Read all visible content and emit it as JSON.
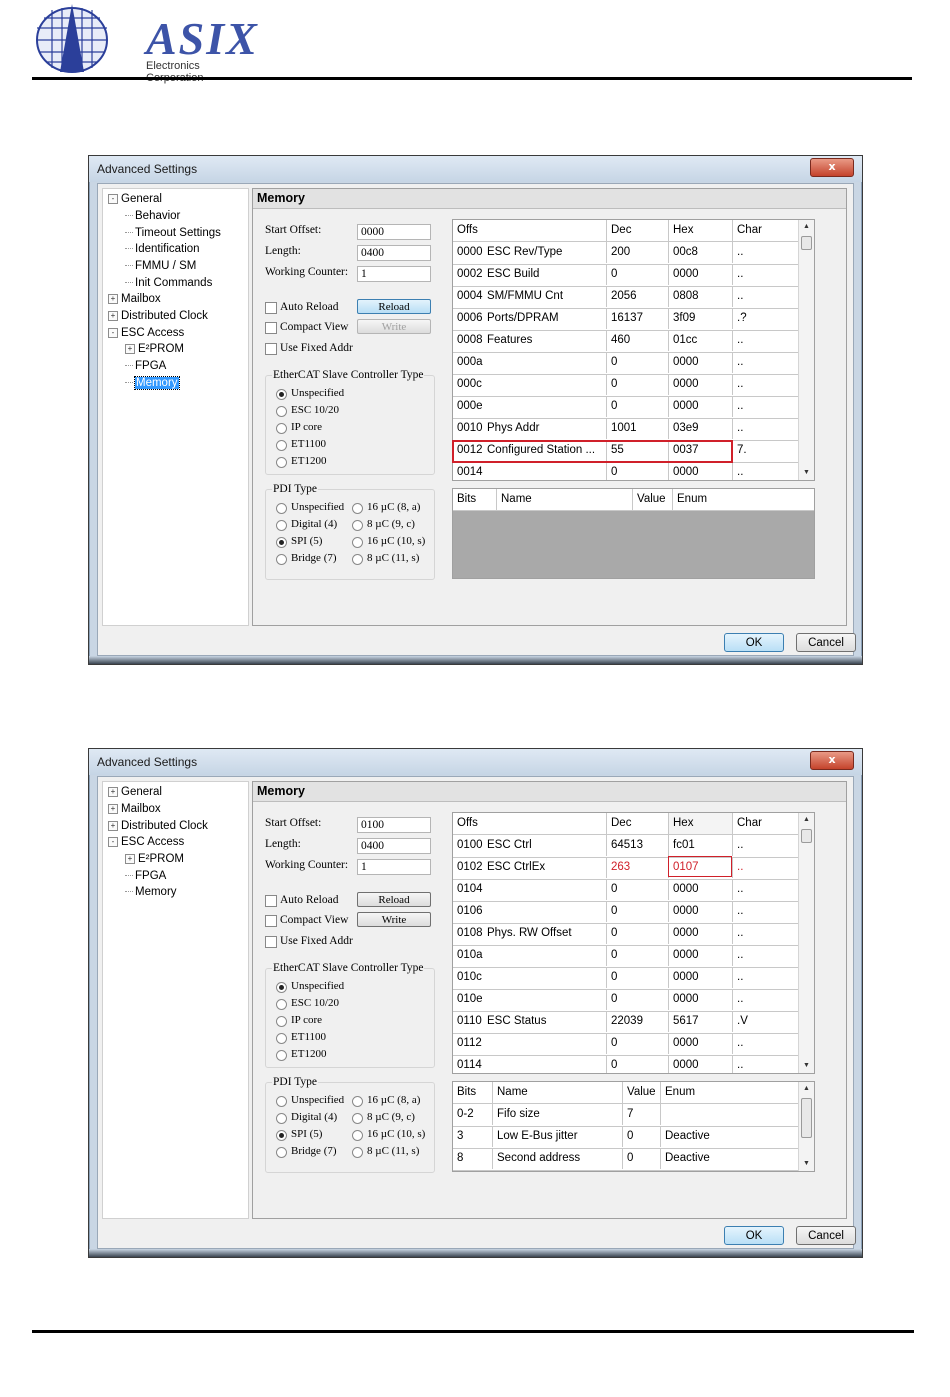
{
  "logo": {
    "brand": "ASIX",
    "subtitle": "Electronics Corporation"
  },
  "dialogs": [
    {
      "title": "Advanced Settings",
      "close_label": "x",
      "tree": [
        {
          "label": "General",
          "level": 0,
          "expander": "-"
        },
        {
          "label": "Behavior",
          "level": 1
        },
        {
          "label": "Timeout Settings",
          "level": 1
        },
        {
          "label": "Identification",
          "level": 1
        },
        {
          "label": "FMMU / SM",
          "level": 1
        },
        {
          "label": "Init Commands",
          "level": 1
        },
        {
          "label": "Mailbox",
          "level": 0,
          "expander": "+"
        },
        {
          "label": "Distributed Clock",
          "level": 0,
          "expander": "+"
        },
        {
          "label": "ESC Access",
          "level": 0,
          "expander": "-"
        },
        {
          "label": "E²PROM",
          "level": 1,
          "expander": "+"
        },
        {
          "label": "FPGA",
          "level": 1
        },
        {
          "label": "Memory",
          "level": 1,
          "selected": true
        }
      ],
      "panel_title": "Memory",
      "start_offset_label": "Start Offset:",
      "start_offset": "0000",
      "length_label": "Length:",
      "length": "0400",
      "working_counter_label": "Working Counter:",
      "working_counter": "1",
      "auto_reload_label": "Auto Reload",
      "reload_label": "Reload",
      "compact_view_label": "Compact View",
      "write_label": "Write",
      "write_disabled": true,
      "use_fixed_addr_label": "Use Fixed Addr",
      "esc_group_label": "EtherCAT Slave Controller Type",
      "esc_types": [
        "Unspecified",
        "ESC 10/20",
        "IP core",
        "ET1100",
        "ET1200"
      ],
      "esc_selected": 0,
      "pdi_group_label": "PDI Type",
      "pdi_left": [
        "Unspecified",
        "Digital (4)",
        "SPI (5)",
        "Bridge (7)"
      ],
      "pdi_right": [
        "16 µC (8, a)",
        "8 µC (9, c)",
        "16 µC (10, s)",
        "8 µC (11, s)"
      ],
      "pdi_selected": "SPI (5)",
      "mem_columns": [
        "Offs",
        "Dec",
        "Hex",
        "Char"
      ],
      "mem_rows": [
        {
          "offs": "0000",
          "name": "ESC Rev/Type",
          "dec": "200",
          "hex": "00c8",
          "char": ".."
        },
        {
          "offs": "0002",
          "name": "ESC Build",
          "dec": "0",
          "hex": "0000",
          "char": ".."
        },
        {
          "offs": "0004",
          "name": "SM/FMMU Cnt",
          "dec": "2056",
          "hex": "0808",
          "char": ".."
        },
        {
          "offs": "0006",
          "name": "Ports/DPRAM",
          "dec": "16137",
          "hex": "3f09",
          "char": ".?"
        },
        {
          "offs": "0008",
          "name": "Features",
          "dec": "460",
          "hex": "01cc",
          "char": ".."
        },
        {
          "offs": "000a",
          "name": "",
          "dec": "0",
          "hex": "0000",
          "char": ".."
        },
        {
          "offs": "000c",
          "name": "",
          "dec": "0",
          "hex": "0000",
          "char": ".."
        },
        {
          "offs": "000e",
          "name": "",
          "dec": "0",
          "hex": "0000",
          "char": ".."
        },
        {
          "offs": "0010",
          "name": "Phys Addr",
          "dec": "1001",
          "hex": "03e9",
          "char": ".."
        },
        {
          "offs": "0012",
          "name": "Configured Station ...",
          "dec": "55",
          "hex": "0037",
          "char": "7."
        },
        {
          "offs": "0014",
          "name": "",
          "dec": "0",
          "hex": "0000",
          "char": ".."
        }
      ],
      "bits_columns": [
        "Bits",
        "Name",
        "Value",
        "Enum"
      ],
      "bits_rows": [],
      "ok_label": "OK",
      "cancel_label": "Cancel"
    },
    {
      "title": "Advanced Settings",
      "close_label": "x",
      "tree": [
        {
          "label": "General",
          "level": 0,
          "expander": "+"
        },
        {
          "label": "Mailbox",
          "level": 0,
          "expander": "+"
        },
        {
          "label": "Distributed Clock",
          "level": 0,
          "expander": "+"
        },
        {
          "label": "ESC Access",
          "level": 0,
          "expander": "-"
        },
        {
          "label": "E²PROM",
          "level": 1,
          "expander": "+"
        },
        {
          "label": "FPGA",
          "level": 1
        },
        {
          "label": "Memory",
          "level": 1
        }
      ],
      "panel_title": "Memory",
      "start_offset_label": "Start Offset:",
      "start_offset": "0100",
      "length_label": "Length:",
      "length": "0400",
      "working_counter_label": "Working Counter:",
      "working_counter": "1",
      "auto_reload_label": "Auto Reload",
      "reload_label": "Reload",
      "compact_view_label": "Compact View",
      "write_label": "Write",
      "write_disabled": false,
      "use_fixed_addr_label": "Use Fixed Addr",
      "esc_group_label": "EtherCAT Slave Controller Type",
      "esc_types": [
        "Unspecified",
        "ESC 10/20",
        "IP core",
        "ET1100",
        "ET1200"
      ],
      "esc_selected": 0,
      "pdi_group_label": "PDI Type",
      "pdi_left": [
        "Unspecified",
        "Digital (4)",
        "SPI (5)",
        "Bridge (7)"
      ],
      "pdi_right": [
        "16 µC (8, a)",
        "8 µC (9, c)",
        "16 µC (10, s)",
        "8 µC (11, s)"
      ],
      "pdi_selected": "SPI (5)",
      "mem_columns": [
        "Offs",
        "Dec",
        "Hex",
        "Char"
      ],
      "mem_rows": [
        {
          "offs": "0100",
          "name": "ESC Ctrl",
          "dec": "64513",
          "hex": "fc01",
          "char": ".."
        },
        {
          "offs": "0102",
          "name": "ESC CtrlEx",
          "dec": "263",
          "hex": "0107",
          "char": ".."
        },
        {
          "offs": "0104",
          "name": "",
          "dec": "0",
          "hex": "0000",
          "char": ".."
        },
        {
          "offs": "0106",
          "name": "",
          "dec": "0",
          "hex": "0000",
          "char": ".."
        },
        {
          "offs": "0108",
          "name": "Phys. RW Offset",
          "dec": "0",
          "hex": "0000",
          "char": ".."
        },
        {
          "offs": "010a",
          "name": "",
          "dec": "0",
          "hex": "0000",
          "char": ".."
        },
        {
          "offs": "010c",
          "name": "",
          "dec": "0",
          "hex": "0000",
          "char": ".."
        },
        {
          "offs": "010e",
          "name": "",
          "dec": "0",
          "hex": "0000",
          "char": ".."
        },
        {
          "offs": "0110",
          "name": "ESC Status",
          "dec": "22039",
          "hex": "5617",
          "char": ".V"
        },
        {
          "offs": "0112",
          "name": "",
          "dec": "0",
          "hex": "0000",
          "char": ".."
        },
        {
          "offs": "0114",
          "name": "",
          "dec": "0",
          "hex": "0000",
          "char": ".."
        }
      ],
      "bits_columns": [
        "Bits",
        "Name",
        "Value",
        "Enum"
      ],
      "bits_rows": [
        {
          "bits": "0-2",
          "name": "Fifo size",
          "value": "7",
          "enum": ""
        },
        {
          "bits": "3",
          "name": "Low E-Bus jitter",
          "value": "0",
          "enum": "Deactive"
        },
        {
          "bits": "8",
          "name": "Second address",
          "value": "0",
          "enum": "Deactive"
        }
      ],
      "ok_label": "OK",
      "cancel_label": "Cancel"
    }
  ]
}
